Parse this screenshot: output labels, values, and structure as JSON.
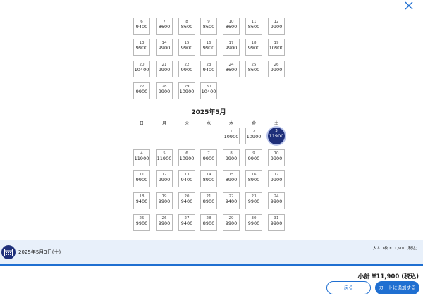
{
  "close_icon": "close-icon",
  "april_rows": [
    [
      {
        "day": "6",
        "price": "9400"
      },
      {
        "day": "7",
        "price": "8600"
      },
      {
        "day": "8",
        "price": "8600"
      },
      {
        "day": "9",
        "price": "8600"
      },
      {
        "day": "10",
        "price": "8600"
      },
      {
        "day": "11",
        "price": "8600"
      },
      {
        "day": "12",
        "price": "9900"
      }
    ],
    [
      {
        "day": "13",
        "price": "9900"
      },
      {
        "day": "14",
        "price": "9900"
      },
      {
        "day": "15",
        "price": "9900"
      },
      {
        "day": "16",
        "price": "9900"
      },
      {
        "day": "17",
        "price": "9900"
      },
      {
        "day": "18",
        "price": "9900"
      },
      {
        "day": "19",
        "price": "10900"
      }
    ],
    [
      {
        "day": "20",
        "price": "10400"
      },
      {
        "day": "21",
        "price": "9900"
      },
      {
        "day": "22",
        "price": "9900"
      },
      {
        "day": "23",
        "price": "9400"
      },
      {
        "day": "24",
        "price": "8600"
      },
      {
        "day": "25",
        "price": "8600"
      },
      {
        "day": "26",
        "price": "9900"
      }
    ],
    [
      {
        "day": "27",
        "price": "9900"
      },
      {
        "day": "28",
        "price": "9900"
      },
      {
        "day": "29",
        "price": "10900"
      },
      {
        "day": "30",
        "price": "10400"
      }
    ]
  ],
  "may_title": "2025年5月",
  "weekdays": [
    "日",
    "月",
    "火",
    "水",
    "木",
    "金",
    "土"
  ],
  "may_rows": [
    [
      null,
      null,
      null,
      null,
      {
        "day": "1",
        "price": "10900"
      },
      {
        "day": "2",
        "price": "10900"
      },
      {
        "day": "3",
        "price": "11900",
        "selected": true
      }
    ],
    [
      {
        "day": "4",
        "price": "11900"
      },
      {
        "day": "5",
        "price": "11900"
      },
      {
        "day": "6",
        "price": "10900"
      },
      {
        "day": "7",
        "price": "9900"
      },
      {
        "day": "8",
        "price": "9900"
      },
      {
        "day": "9",
        "price": "9900"
      },
      {
        "day": "10",
        "price": "9900"
      }
    ],
    [
      {
        "day": "11",
        "price": "9900"
      },
      {
        "day": "12",
        "price": "9900"
      },
      {
        "day": "13",
        "price": "9400"
      },
      {
        "day": "14",
        "price": "8900"
      },
      {
        "day": "15",
        "price": "8900"
      },
      {
        "day": "16",
        "price": "8900"
      },
      {
        "day": "17",
        "price": "9900"
      }
    ],
    [
      {
        "day": "18",
        "price": "9400"
      },
      {
        "day": "19",
        "price": "9900"
      },
      {
        "day": "20",
        "price": "9400"
      },
      {
        "day": "21",
        "price": "8900"
      },
      {
        "day": "22",
        "price": "9400"
      },
      {
        "day": "23",
        "price": "9900"
      },
      {
        "day": "24",
        "price": "9900"
      }
    ],
    [
      {
        "day": "25",
        "price": "9900"
      },
      {
        "day": "26",
        "price": "9900"
      },
      {
        "day": "27",
        "price": "9400"
      },
      {
        "day": "28",
        "price": "8900"
      },
      {
        "day": "29",
        "price": "9900"
      },
      {
        "day": "30",
        "price": "9900"
      },
      {
        "day": "31",
        "price": "9900"
      }
    ]
  ],
  "selection": {
    "date_label": "2025年5月3日(土)",
    "summary": "大人 1枚 ¥11,900 (税込)",
    "calendar_icon": "calendar-icon"
  },
  "footer": {
    "subtotal": "小計 ¥11,900 (税込)",
    "back_label": "戻る",
    "add_to_cart_label": "カートに追加する"
  },
  "colors": {
    "accent": "#1f6fd1",
    "selected_day": "#1e2f7a",
    "info_bar": "#e8f0fa"
  }
}
